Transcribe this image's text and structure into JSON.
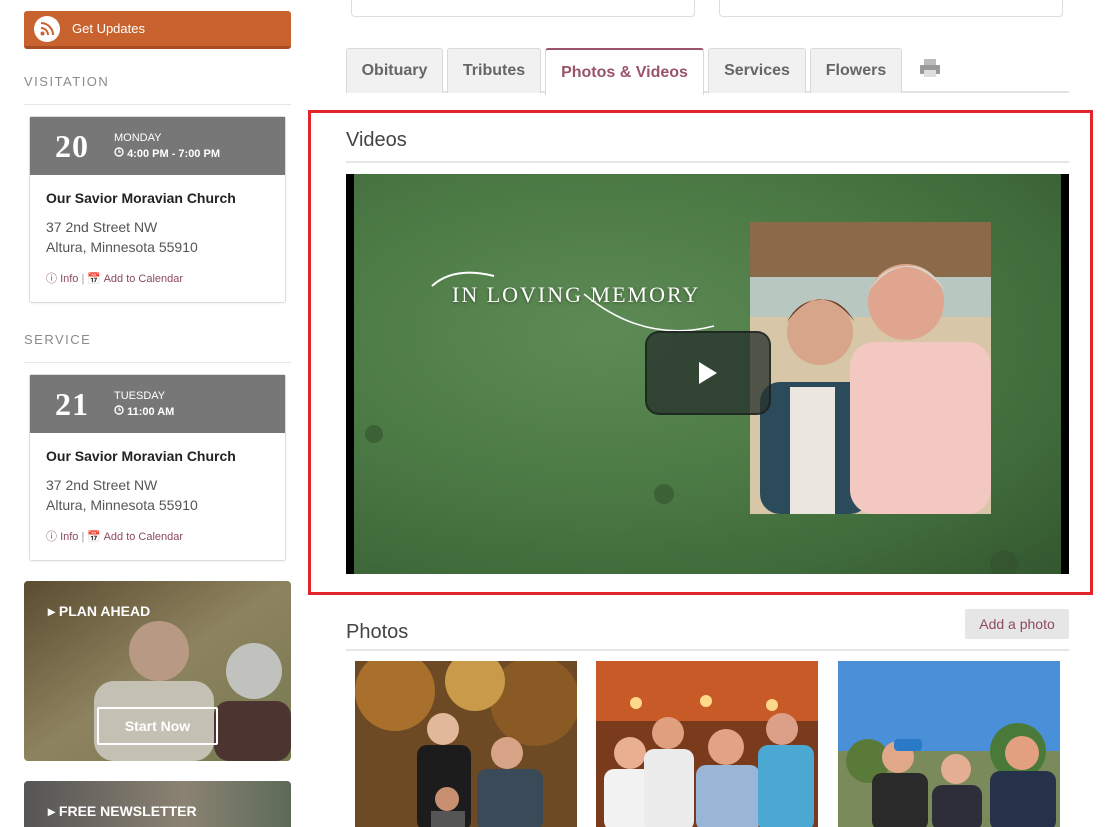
{
  "sidebar": {
    "updates_label": "Get Updates",
    "visitation": {
      "heading": "VISITATION",
      "day": "20",
      "weekday": "MONDAY",
      "time": "4:00 PM - 7:00 PM",
      "location": "Our Savior Moravian Church",
      "address_line1": "37 2nd Street NW",
      "address_line2": "Altura, Minnesota 55910",
      "info_label": "Info",
      "separator": "|",
      "calendar_label": "Add to Calendar"
    },
    "service": {
      "heading": "SERVICE",
      "day": "21",
      "weekday": "TUESDAY",
      "time": "11:00 AM",
      "location": "Our Savior Moravian Church",
      "address_line1": "37 2nd Street NW",
      "address_line2": "Altura, Minnesota 55910",
      "info_label": "Info",
      "separator": "|",
      "calendar_label": "Add to Calendar"
    },
    "plan_ahead": {
      "title": "PLAN AHEAD",
      "button": "Start Now"
    },
    "newsletter": {
      "title": "FREE NEWSLETTER"
    }
  },
  "tabs": [
    {
      "label": "Obituary"
    },
    {
      "label": "Tributes"
    },
    {
      "label": "Photos & Videos",
      "active": true
    },
    {
      "label": "Services"
    },
    {
      "label": "Flowers"
    }
  ],
  "videos": {
    "heading": "Videos",
    "overlay_title": "IN LOVING MEMORY"
  },
  "photos": {
    "heading": "Photos",
    "add_label": "Add a photo"
  },
  "colors": {
    "accent": "#9a5468",
    "updates_button": "#c8622e",
    "highlight_border": "#e2242b"
  },
  "icons": [
    "rss-icon",
    "clock-icon",
    "info-icon",
    "calendar-icon",
    "caret-right-icon",
    "print-icon",
    "play-icon"
  ]
}
